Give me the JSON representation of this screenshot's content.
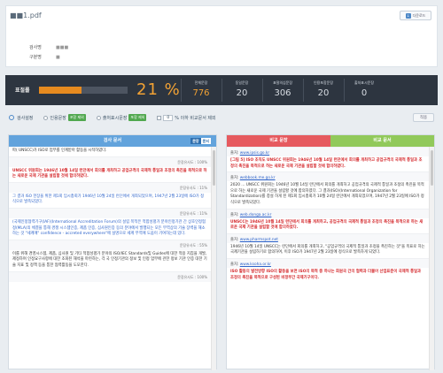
{
  "header": {
    "file_title": "■■1.pdf",
    "download_label": "다운로드",
    "meta": [
      {
        "label": "검사명",
        "value": "■■■"
      },
      {
        "label": "구분명",
        "value": "■"
      }
    ]
  },
  "stats": {
    "label": "표절률",
    "percent_text": "21 %",
    "bar_fraction": 0.48,
    "items": [
      {
        "title": "전체문장",
        "value": "776",
        "tone": "orange"
      },
      {
        "title": "동일문장",
        "value": "20",
        "tone": "grey"
      },
      {
        "title": "표절의심문장",
        "value": "306",
        "tone": "grey"
      },
      {
        "title": "인용포함문장",
        "value": "20",
        "tone": "grey"
      },
      {
        "title": "출처표시문장",
        "value": "0",
        "tone": "grey"
      }
    ]
  },
  "settings": {
    "title": "검사설정",
    "opt1": "인용문장",
    "opt1_badge": "포함 제외",
    "opt2": "출처표시문장",
    "opt2_badge": "포함 제외",
    "threshold_value": "0",
    "threshold_text": "% 이하 비교문서 제외",
    "apply_label": "적용"
  },
  "left": {
    "title": "검사 문서",
    "toggle_on": "문장",
    "toggle_off": "문서",
    "items": [
      {
        "text": "파( UNSCC)가 ISO로 업무를 인계받아 활동을 시작하였다.",
        "tone": "normal",
        "sim": "문장유사도 : 100%"
      },
      {
        "text": "UNSCC 위원회는 1946년 10월 14일 런던에서 회의를 개최하고 공업규격의 국제적 통일과 조정의 촉진을 목적으로 하는 새로운 국제 기관을 설립할 것에 합의하였다.",
        "tone": "red",
        "sim": "문장유사도 : 11%"
      },
      {
        "text": "그 결과 ISO 헌장을 위한 제1회 임시총회가 1946년 10월 24일 런던에서 개최되었으며, 1947년 2월 23일에 ISO가 정식으로 발족되었다.",
        "tone": "blue",
        "sim": "문장유사도 : 11%"
      },
      {
        "text": "(국제인정협력기구(IAF)(International Accreditation Forum)의 설립 목적은 적합성평가 분야인정기관 간 상호인정협정(MLA)의 체결을 통해 경쟁 시스템인증, 제품 인증, 심사원인증 등의 분야에서 발행되는 모든 무역상의 기술 장벽을 해소하는 것 \"세계에\" confidence - accreted everywhere\"에 설명으로 세계 무역에 도움이 기여하는데 있다.",
        "tone": "blue",
        "sim": "문장유사도 : 55%"
      },
      {
        "text": "이를 위해 경영시스템, 제품, 심사원 및 기타 적합성평가 분야의 ISO/IEC Standards및 Guides에 대한 적용 지침을 개발, 제정하며 인정요구사항에 대한 조화된 해석을 마련하는, 각 국 인정기관의 정보 및 인정 업무에 관한 정보 기관 인증 대한 기술 지표 및 정책 등을 통한 협력활동을 도모한다.",
        "tone": "normal",
        "sim": "문장유사도 : 100%"
      }
    ]
  },
  "right": {
    "title_a": "비교 문장",
    "title_b": "비교 문서",
    "items": [
      {
        "source_label": "출처:",
        "source": "www.ipsis.go.kr",
        "text": "[그림 5] ISO 조직도 UNSCC 위원회는 1946년 10월 14일 런던에서 회의를 개최하고 공업규격의 국제적 통일과 조정의 촉진을 목적으로 하는 새로운 국제 기관을 설립할 것에 합의하였다."
      },
      {
        "source_label": "출처:",
        "source": "webbook.me.go.kr",
        "text": "2020 ... UNSCC 위원회는 1946년 10월 14일 런던에서 회의를 개최하고 공업규격의 국제적 통일과 조정의 촉진을 목적으로 하는 새로운 국제 기관을 설립할 것에 합의하였다. 그 결과(ISO)(International Organization for Standardization)를 창설 하게 된 제1회 임시총회가 10월 24일 런던에서 개최되었으며, 1947년 2월 23일에 ISO가 정식으로 발족되었다."
      },
      {
        "source_label": "출처:",
        "source": "web.donga.ac.kr",
        "text": "UNSCC는 1946년 10월 14일 런던에서 회의를 개최하고, 공업규격의 국제적 통일과 조정의 촉진을 목적으로 하는 새로운 국제 기관을 설립할 것에 합의하였다."
      },
      {
        "source_label": "출처:",
        "source": "www.pharmspot.net",
        "text": "1946년 10월 14일 UNSCC는 런던에서 회의를 개최하고, \"공업규격의 국제적 통일과 조정을 촉진하는 것\"을 목표로 하는 국제기관을 설립하기로 합의하여, 이후 ISO가 1947년 2월 23일에 정식으로 발족하게 되었다."
      },
      {
        "source_label": "출처:",
        "source": "www.ksoha.or.kr",
        "text": "ISO 활동의 발전방향 ISO의 활동을 보면 ISO의 목적 중 하나는 회원국 간의 협력과 더불어 산업표준이 국제적 통일과 조정의 촉진을 목적으로 구성된 비정부간 국제기구이다."
      }
    ]
  }
}
